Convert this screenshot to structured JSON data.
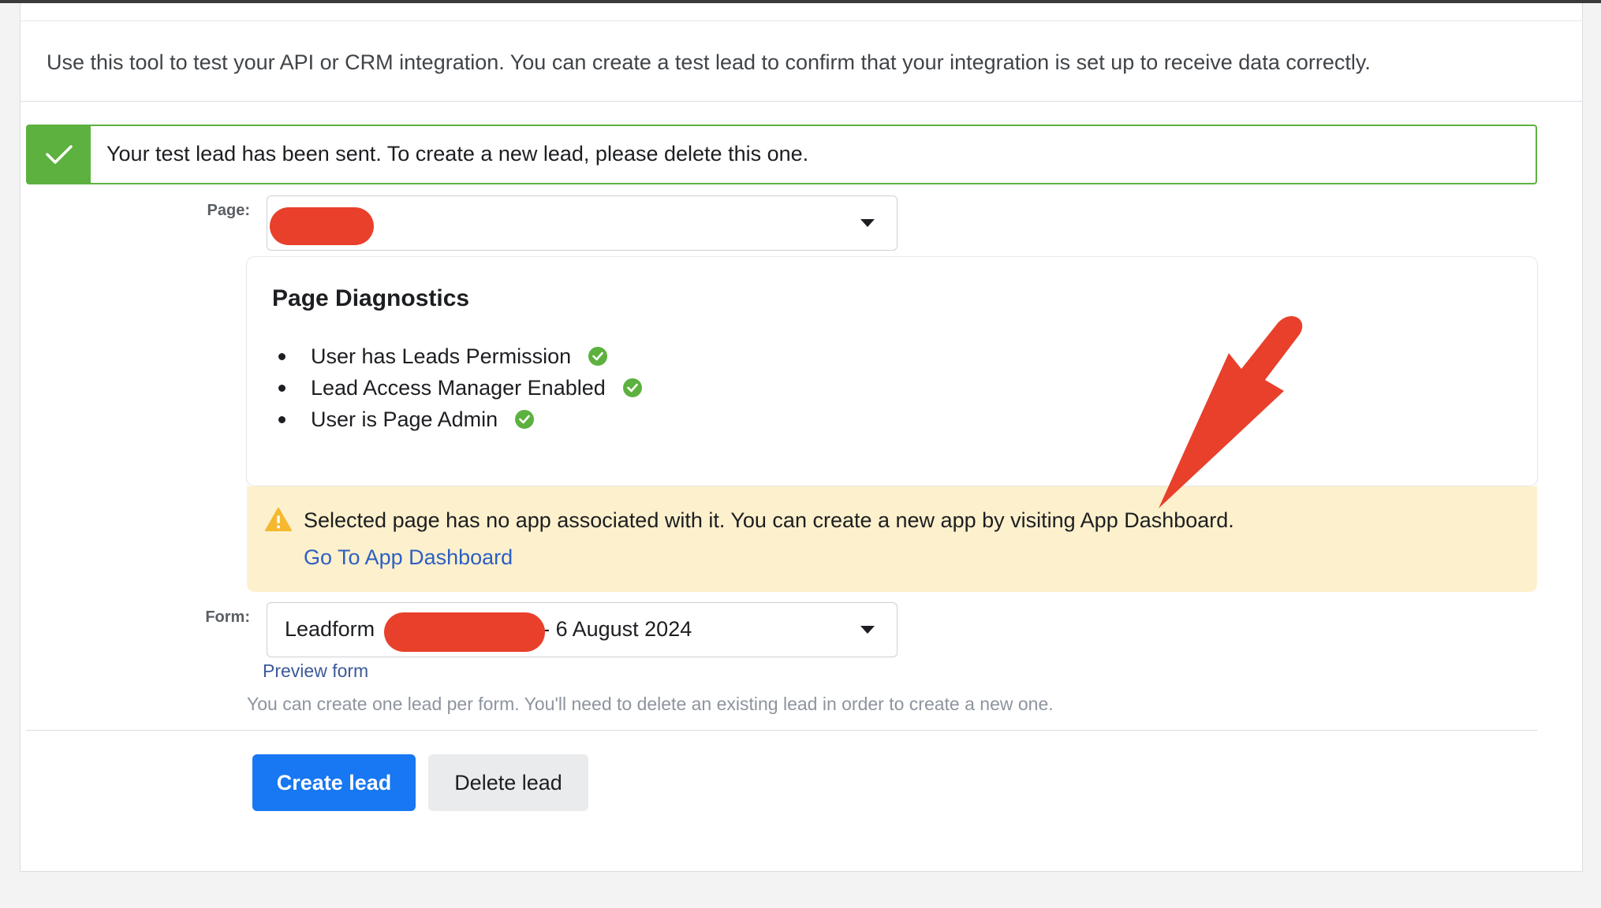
{
  "intro": {
    "text": "Use this tool to test your API or CRM integration. You can create a test lead to confirm that your integration is set up to receive data correctly."
  },
  "success_banner": {
    "icon": "checkmark-icon",
    "text": "Your test lead has been sent. To create a new lead, please delete this one."
  },
  "page_field": {
    "label": "Page:",
    "selected_value": ""
  },
  "diagnostics": {
    "title": "Page Diagnostics",
    "items": [
      {
        "label": "User has Leads Permission",
        "status_icon": "check-circle-icon"
      },
      {
        "label": "Lead Access Manager Enabled",
        "status_icon": "check-circle-icon"
      },
      {
        "label": "User is Page Admin",
        "status_icon": "check-circle-icon"
      }
    ]
  },
  "warning": {
    "icon": "warning-triangle-icon",
    "text": "Selected page has no app associated with it. You can create a new app by visiting App Dashboard.",
    "link": "Go To App Dashboard"
  },
  "form_field": {
    "label": "Form:",
    "value_prefix": "Leadform",
    "value_suffix": "- 6 August 2024",
    "preview_link": "Preview form",
    "hint": "You can create one lead per form. You'll need to delete an existing lead in order to create a new one."
  },
  "actions": {
    "create": "Create lead",
    "delete": "Delete lead"
  },
  "colors": {
    "success_green": "#5db13f",
    "primary_blue": "#1877f2",
    "link_blue": "#2c5fc4",
    "warning_bg": "#fdf0cc",
    "warning_icon": "#f5b82e",
    "annotation_red": "#e8402b"
  }
}
